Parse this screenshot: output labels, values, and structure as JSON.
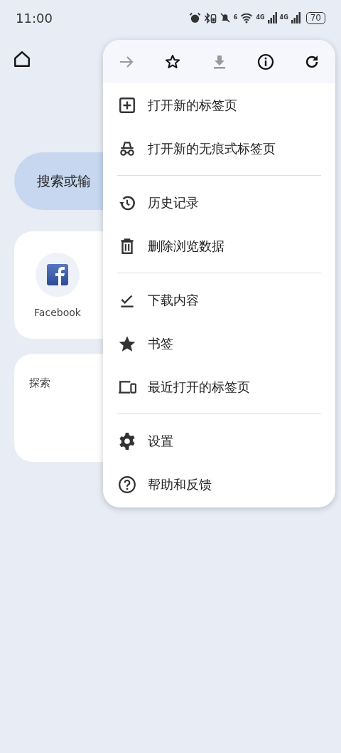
{
  "status_bar": {
    "time": "11:00",
    "wifi_label": "6",
    "signal_labels": [
      "4G",
      "4G"
    ],
    "battery": "70"
  },
  "home": {
    "search_placeholder": "搜索或输"
  },
  "shortcuts": [
    {
      "label": "Facebook"
    }
  ],
  "explore": {
    "title": "探索"
  },
  "menu": {
    "toolbar": [
      {
        "kind": "forward",
        "disabled": true
      },
      {
        "kind": "star",
        "disabled": false
      },
      {
        "kind": "download",
        "disabled": true
      },
      {
        "kind": "info",
        "disabled": false
      },
      {
        "kind": "refresh",
        "disabled": false
      }
    ],
    "sections": [
      [
        {
          "kind": "new-tab",
          "label": "打开新的标签页"
        },
        {
          "kind": "incognito",
          "label": "打开新的无痕式标签页"
        }
      ],
      [
        {
          "kind": "history",
          "label": "历史记录"
        },
        {
          "kind": "delete",
          "label": "删除浏览数据"
        }
      ],
      [
        {
          "kind": "downloads",
          "label": "下载内容"
        },
        {
          "kind": "bookmarks",
          "label": "书签"
        },
        {
          "kind": "recent-tabs",
          "label": "最近打开的标签页"
        }
      ],
      [
        {
          "kind": "settings",
          "label": "设置"
        },
        {
          "kind": "help",
          "label": "帮助和反馈"
        }
      ]
    ]
  }
}
